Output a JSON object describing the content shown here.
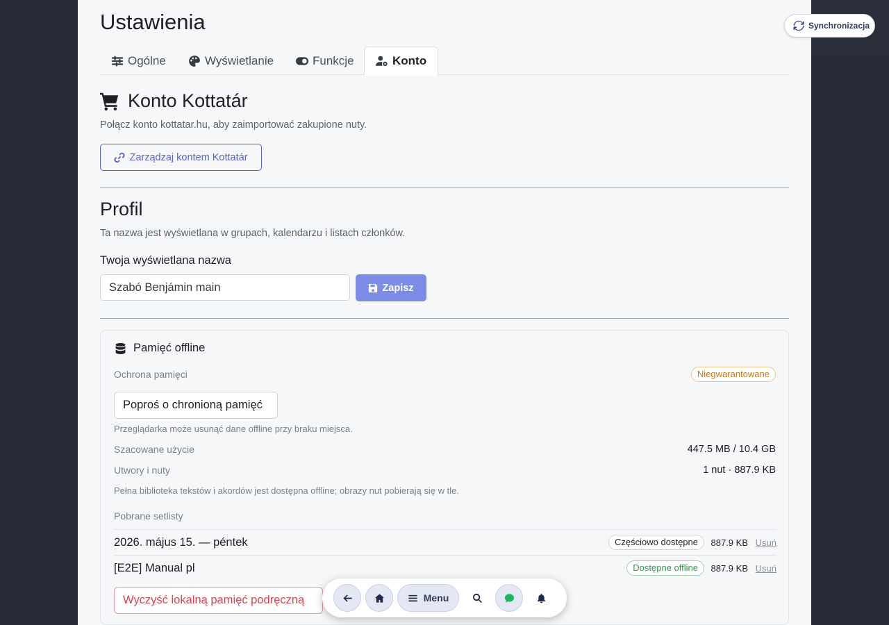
{
  "page": {
    "title": "Ustawienia"
  },
  "tabs": [
    {
      "label": "Ogólne",
      "icon": "sliders-icon"
    },
    {
      "label": "Wyświetlanie",
      "icon": "palette-icon"
    },
    {
      "label": "Funkcje",
      "icon": "toggle-icon"
    },
    {
      "label": "Konto",
      "icon": "user-gear-icon",
      "active": true
    }
  ],
  "kottatar": {
    "heading": "Konto Kottatár",
    "description": "Połącz konto kottatar.hu, aby zaimportować zakupione nuty.",
    "manage_button": "Zarządzaj kontem Kottatár"
  },
  "profile": {
    "heading": "Profil",
    "description": "Ta nazwa jest wyświetlana w grupach, kalendarzu i listach członków.",
    "name_label": "Twoja wyświetlana nazwa",
    "name_value": "Szabó Benjámin main",
    "save_button": "Zapisz"
  },
  "offline": {
    "title": "Pamięć offline",
    "protection_label": "Ochrona pamięci",
    "protection_badge": "Niegwarantowane",
    "request_button": "Poproś o chronioną pamięć",
    "request_note": "Przeglądarka może usunąć dane offline przy braku miejsca.",
    "usage_label": "Szacowane użycie",
    "usage_value": "447.5 MB / 10.4 GB",
    "songs_label": "Utwory i nuty",
    "songs_value": "1 nut · 887.9 KB",
    "library_note": "Pełna biblioteka tekstów i akordów jest dostępna offline; obrazy nut pobierają się w tle.",
    "setlists_label": "Pobrane setlisty",
    "setlists": [
      {
        "name": "2026. május 15. — péntek",
        "status": "Częściowo dostępne",
        "size": "887.9 KB",
        "remove": "Usuń"
      },
      {
        "name": "[E2E] Manual pl",
        "status": "Dostępne offline",
        "size": "887.9 KB",
        "remove": "Usuń"
      }
    ],
    "clear_button": "Wyczyść lokalną pamięć podręczną"
  },
  "sync": {
    "label": "Synchronizacja"
  },
  "bottom_nav": {
    "menu_label": "Menu"
  },
  "colors": {
    "accent": "#5b63c7",
    "save_bg": "#7d8ce6",
    "danger": "#d64550",
    "warning": "#c27a1a",
    "success": "#2e9a4f",
    "sidebar_bg": "#272a35"
  }
}
